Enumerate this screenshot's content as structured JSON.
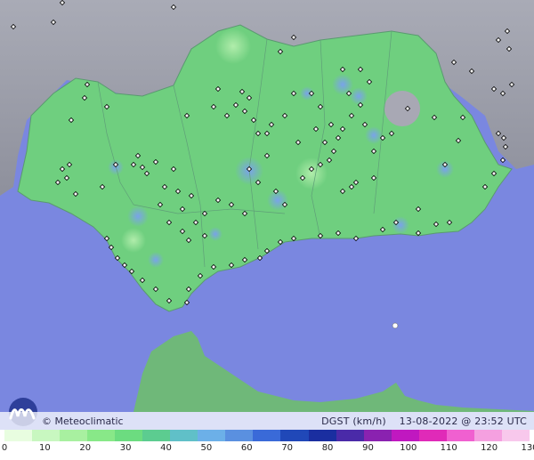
{
  "footer": {
    "credit": "© Meteoclimatic",
    "variable": "DGST (km/h)",
    "datetime": "13-08-2022 @ 23:52 UTC"
  },
  "legend": {
    "ticks": [
      "0",
      "10",
      "20",
      "30",
      "40",
      "50",
      "60",
      "70",
      "80",
      "90",
      "100",
      "110",
      "120",
      "130"
    ],
    "colors": [
      "#e8fde0",
      "#c8f7c0",
      "#a8f0a0",
      "#88e888",
      "#6cdc80",
      "#5ccc90",
      "#60c0c8",
      "#6cb0e8",
      "#5a90e0",
      "#3a6ad8",
      "#2048b8",
      "#1a2ea0",
      "#4a2aa8",
      "#8a22b0",
      "#c018c0",
      "#e02ab8",
      "#f060d0",
      "#f5a0e0",
      "#f8c8ec"
    ],
    "accent": "#6cdc80"
  },
  "map": {
    "sea_color": "#7a87e0",
    "land_color": "#6fcf7f",
    "outside_color": "#9a9ca8",
    "hotspot_color": "#8aa8e8"
  }
}
